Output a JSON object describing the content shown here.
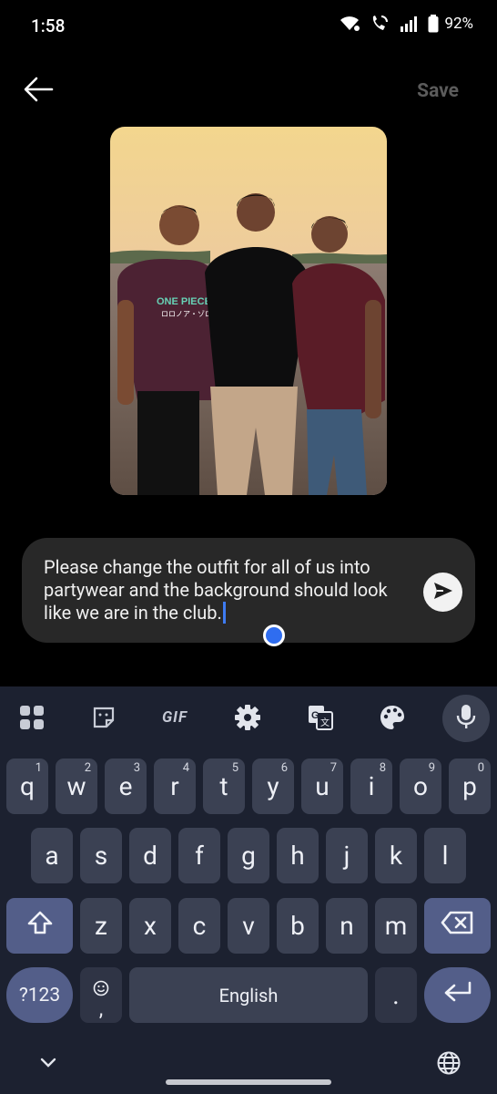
{
  "status_bar": {
    "time": "1:58",
    "battery_percent": "92%",
    "icons": [
      "wifi-icon",
      "wifi-calling-icon",
      "signal-icon",
      "battery-icon"
    ]
  },
  "top_bar": {
    "back_icon": "arrow-left-icon",
    "save_label": "Save"
  },
  "photo": {
    "description_icon": "image-photo",
    "shirt_text_line1": "ONE PIECE",
    "shirt_text_line2": "ロロノア・ゾロ"
  },
  "prompt": {
    "text": "Please change the outfit for all of us into partywear and the background should look like we are in the club.",
    "send_icon": "send-icon"
  },
  "keyboard": {
    "toolbar": [
      {
        "name": "apps-grid-icon"
      },
      {
        "name": "sticker-icon"
      },
      {
        "name": "gif-button",
        "label": "GIF"
      },
      {
        "name": "settings-gear-icon"
      },
      {
        "name": "translate-icon"
      },
      {
        "name": "palette-icon"
      },
      {
        "name": "mic-icon"
      }
    ],
    "row1": [
      {
        "key": "q",
        "hint": "1"
      },
      {
        "key": "w",
        "hint": "2"
      },
      {
        "key": "e",
        "hint": "3"
      },
      {
        "key": "r",
        "hint": "4"
      },
      {
        "key": "t",
        "hint": "5"
      },
      {
        "key": "y",
        "hint": "6"
      },
      {
        "key": "u",
        "hint": "7"
      },
      {
        "key": "i",
        "hint": "8"
      },
      {
        "key": "o",
        "hint": "9"
      },
      {
        "key": "p",
        "hint": "0"
      }
    ],
    "row2": [
      "a",
      "s",
      "d",
      "f",
      "g",
      "h",
      "j",
      "k",
      "l"
    ],
    "row3": [
      "z",
      "x",
      "c",
      "v",
      "b",
      "n",
      "m"
    ],
    "symbols_label": "?123",
    "emoji_comma": ",",
    "space_label": "English",
    "period_label": ".",
    "shift_icon": "shift-icon",
    "backspace_icon": "backspace-icon",
    "enter_icon": "enter-icon"
  },
  "nav": {
    "hide_keyboard_icon": "chevron-down-icon",
    "language_icon": "globe-icon"
  },
  "colors": {
    "background": "#000000",
    "prompt_box": "#282828",
    "keyboard_bg": "#1c2130",
    "key_bg": "#3b4153",
    "modifier_key": "#535e89",
    "accent": "#2f6df0"
  }
}
